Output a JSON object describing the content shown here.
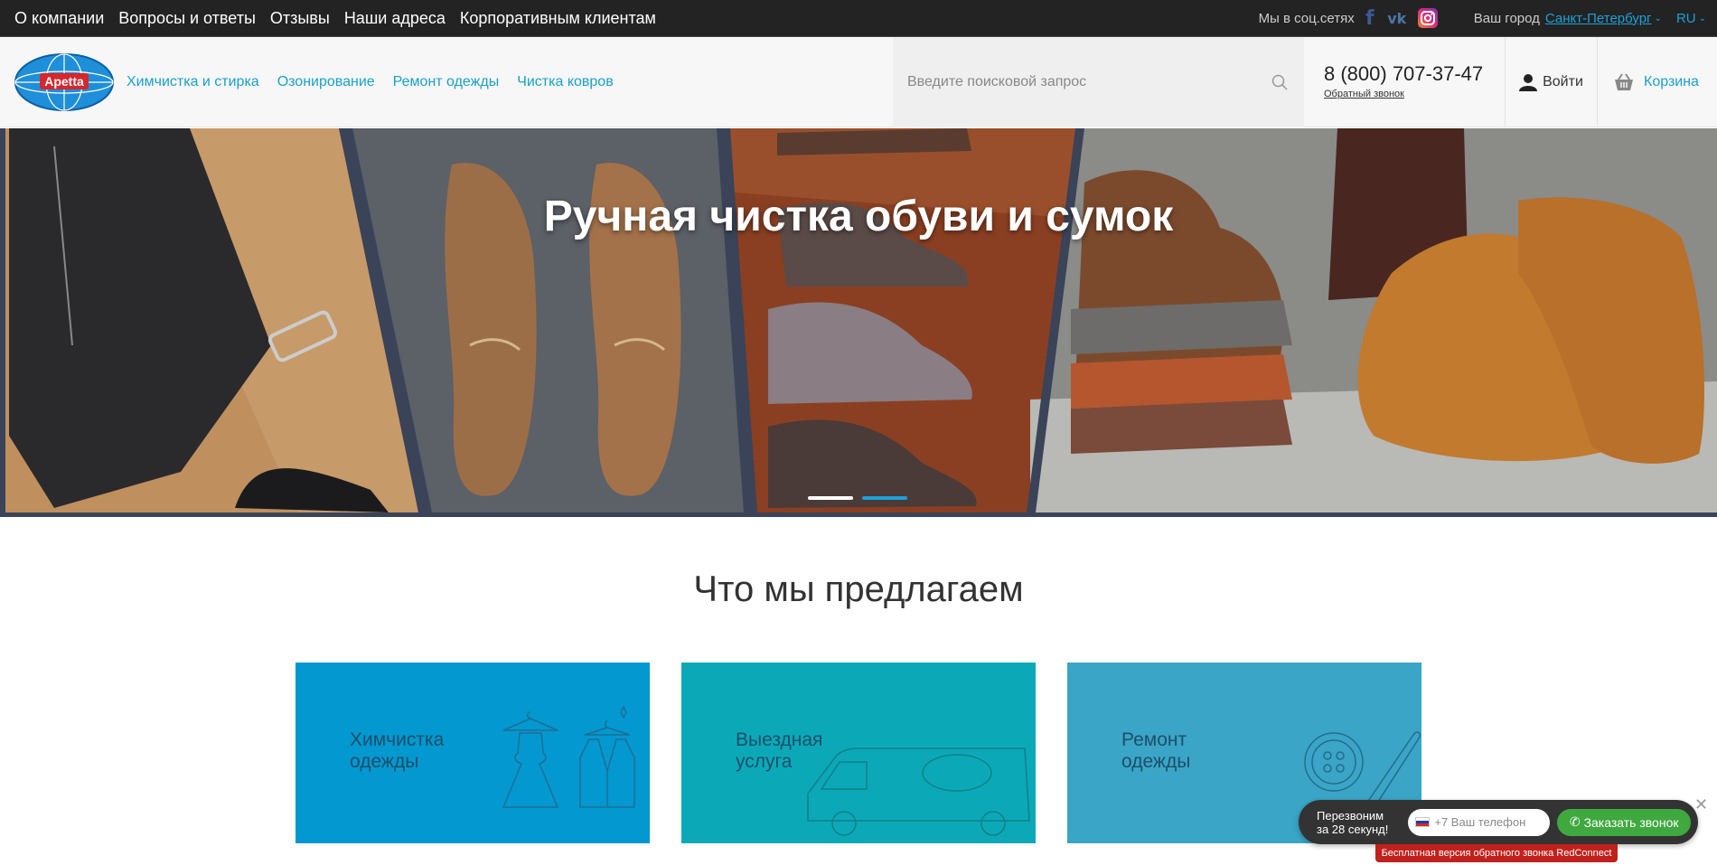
{
  "topbar": {
    "links": [
      "О компании",
      "Вопросы и ответы",
      "Отзывы",
      "Наши адреса",
      "Корпоративным клиентам"
    ],
    "social_label": "Мы в соц.сетях",
    "city_label": "Ваш город",
    "city": "Санкт-Петербург",
    "lang": "RU"
  },
  "header": {
    "logo_text": "Apetta",
    "services": [
      "Химчистка и стирка",
      "Озонирование",
      "Ремонт одежды",
      "Чистка ковров"
    ],
    "search_placeholder": "Введите поисковой запрос",
    "phone": "8 (800) 707-37-47",
    "callback": "Обратный звонок",
    "login": "Войти",
    "cart": "Корзина"
  },
  "hero": {
    "title": "Ручная чистка обуви и сумок",
    "slides": 2,
    "active_slide": 1
  },
  "section": {
    "title": "Что мы предлагаем"
  },
  "cards": [
    {
      "line1": "Химчистка",
      "line2": "одежды",
      "color": "#0398cf"
    },
    {
      "line1": "Выездная",
      "line2": "услуга",
      "color": "#0ba9b8"
    },
    {
      "line1": "Ремонт",
      "line2": "одежды",
      "color": "#3aa5c7"
    }
  ],
  "widget": {
    "text1": "Перезвоним",
    "text2": "за 28 секунд!",
    "input_placeholder": "+7 Ваш телефон",
    "button": "Заказать звонок",
    "badge": "Бесплатная версия обратного звонка RedConnect"
  },
  "colors": {
    "accent": "#1aa0c8",
    "topbar_bg": "#232323",
    "widget_button": "#3fa83f"
  }
}
